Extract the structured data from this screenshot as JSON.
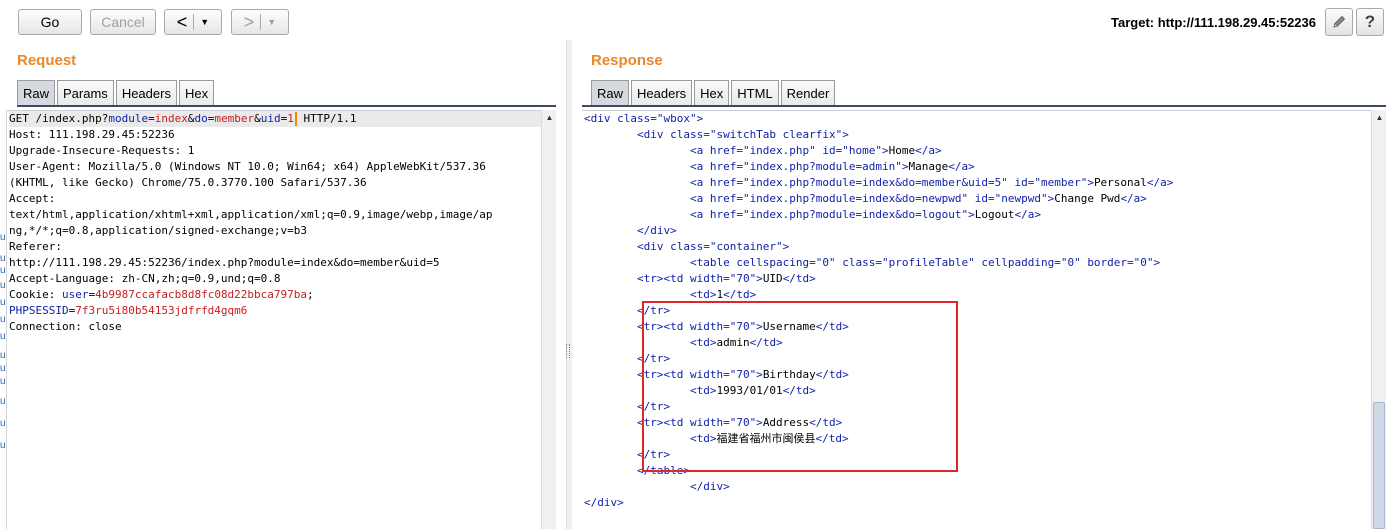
{
  "toolbar": {
    "go_label": "Go",
    "cancel_label": "Cancel",
    "back_label": "<",
    "forward_label": ">",
    "target_text": "Target: http://111.198.29.45:52236",
    "help_label": "?"
  },
  "request": {
    "title": "Request",
    "tabs": [
      "Raw",
      "Params",
      "Headers",
      "Hex"
    ]
  },
  "response": {
    "title": "Response",
    "tabs": [
      "Raw",
      "Headers",
      "Hex",
      "HTML",
      "Render"
    ]
  },
  "request_lines": [
    [
      [
        "t",
        "GET /index.php?"
      ],
      [
        "k",
        "module"
      ],
      [
        "t",
        "="
      ],
      [
        "v",
        "index"
      ],
      [
        "t",
        "&"
      ],
      [
        "k",
        "do"
      ],
      [
        "t",
        "="
      ],
      [
        "v",
        "member"
      ],
      [
        "t",
        "&"
      ],
      [
        "k",
        "uid"
      ],
      [
        "t",
        "="
      ],
      [
        "v",
        "1"
      ],
      [
        "caret",
        ""
      ],
      [
        "t",
        " HTTP/1.1"
      ]
    ],
    [
      [
        "t",
        "Host: 111.198.29.45:52236"
      ]
    ],
    [
      [
        "t",
        "Upgrade-Insecure-Requests: 1"
      ]
    ],
    [
      [
        "t",
        "User-Agent: Mozilla/5.0 (Windows NT 10.0; Win64; x64) AppleWebKit/537.36"
      ]
    ],
    [
      [
        "t",
        "(KHTML, like Gecko) Chrome/75.0.3770.100 Safari/537.36"
      ]
    ],
    [
      [
        "t",
        "Accept:"
      ]
    ],
    [
      [
        "t",
        "text/html,application/xhtml+xml,application/xml;q=0.9,image/webp,image/ap"
      ]
    ],
    [
      [
        "t",
        "ng,*/*;q=0.8,application/signed-exchange;v=b3"
      ]
    ],
    [
      [
        "t",
        "Referer:"
      ]
    ],
    [
      [
        "t",
        "http://111.198.29.45:52236/index.php?module=index&do=member&uid=5"
      ]
    ],
    [
      [
        "t",
        "Accept-Language: zh-CN,zh;q=0.9,und;q=0.8"
      ]
    ],
    [
      [
        "t",
        "Cookie: "
      ],
      [
        "k",
        "user"
      ],
      [
        "t",
        "="
      ],
      [
        "v",
        "4b9987ccafacb8d8fc08d22bbca797ba"
      ],
      [
        "t",
        ";"
      ]
    ],
    [
      [
        "k",
        "PHPSESSID"
      ],
      [
        "t",
        "="
      ],
      [
        "v",
        "7f3ru5i80b54153jdfrfd4gqm6"
      ]
    ],
    [
      [
        "t",
        "Connection: close"
      ]
    ]
  ],
  "response_lines": [
    [
      [
        "g",
        "<div class=\"wbox\">"
      ]
    ],
    [
      [
        "g",
        "        <div class=\"switchTab clearfix\">"
      ]
    ],
    [
      [
        "g",
        "                <a href=\"index.php\" id=\"home\">"
      ],
      [
        "t",
        "Home"
      ],
      [
        "g",
        "</a>"
      ]
    ],
    [
      [
        "g",
        "                <a href=\"index.php?module=admin\">"
      ],
      [
        "t",
        "Manage"
      ],
      [
        "g",
        "</a>"
      ]
    ],
    [
      [
        "g",
        "                <a href=\"index.php?module=index&do=member&uid=5\" id=\"member\">"
      ],
      [
        "t",
        "Personal"
      ],
      [
        "g",
        "</a>"
      ]
    ],
    [
      [
        "g",
        "                <a href=\"index.php?module=index&do=newpwd\" id=\"newpwd\">"
      ],
      [
        "t",
        "Change Pwd"
      ],
      [
        "g",
        "</a>"
      ]
    ],
    [
      [
        "g",
        "                <a href=\"index.php?module=index&do=logout\">"
      ],
      [
        "t",
        "Logout"
      ],
      [
        "g",
        "</a>"
      ]
    ],
    [
      [
        "g",
        "        </div>"
      ]
    ],
    [
      [
        "g",
        "        <div class=\"container\">"
      ]
    ],
    [
      [
        "g",
        "                <table cellspacing=\"0\" class=\"profileTable\" cellpadding=\"0\" border=\"0\">"
      ]
    ],
    [
      [
        "g",
        "        <tr><td width=\"70\">"
      ],
      [
        "t",
        "UID"
      ],
      [
        "g",
        "</td>"
      ]
    ],
    [
      [
        "g",
        "                <td>"
      ],
      [
        "t",
        "1"
      ],
      [
        "g",
        "</td>"
      ]
    ],
    [
      [
        "g",
        "        </tr>"
      ]
    ],
    [
      [
        "g",
        "        <tr><td width=\"70\">"
      ],
      [
        "t",
        "Username"
      ],
      [
        "g",
        "</td>"
      ]
    ],
    [
      [
        "g",
        "                <td>"
      ],
      [
        "t",
        "admin"
      ],
      [
        "g",
        "</td>"
      ]
    ],
    [
      [
        "g",
        "        </tr>"
      ]
    ],
    [
      [
        "g",
        "        <tr><td width=\"70\">"
      ],
      [
        "t",
        "Birthday"
      ],
      [
        "g",
        "</td>"
      ]
    ],
    [
      [
        "g",
        "                <td>"
      ],
      [
        "t",
        "1993/01/01"
      ],
      [
        "g",
        "</td>"
      ]
    ],
    [
      [
        "g",
        "        </tr>"
      ]
    ],
    [
      [
        "g",
        "        <tr><td width=\"70\">"
      ],
      [
        "t",
        "Address"
      ],
      [
        "g",
        "</td>"
      ]
    ],
    [
      [
        "g",
        "                <td>"
      ],
      [
        "t",
        "福建省福州市闽侯县"
      ],
      [
        "g",
        "</td>"
      ]
    ],
    [
      [
        "g",
        "        </tr>"
      ]
    ],
    [
      [
        "g",
        "        </table>"
      ]
    ],
    [
      [
        "g",
        "                </div>"
      ]
    ],
    [
      [
        "g",
        "</div>"
      ]
    ]
  ],
  "gutter_marks": [
    "u",
    "u",
    "u",
    "u",
    "u",
    "u",
    "u",
    "u",
    "u",
    "u",
    "u",
    "u",
    "u"
  ],
  "colors": {
    "accent_title": "#e8892c",
    "param_key": "#0d1fa8",
    "param_value": "#c81d1d",
    "highlight_box": "#e0262b"
  }
}
